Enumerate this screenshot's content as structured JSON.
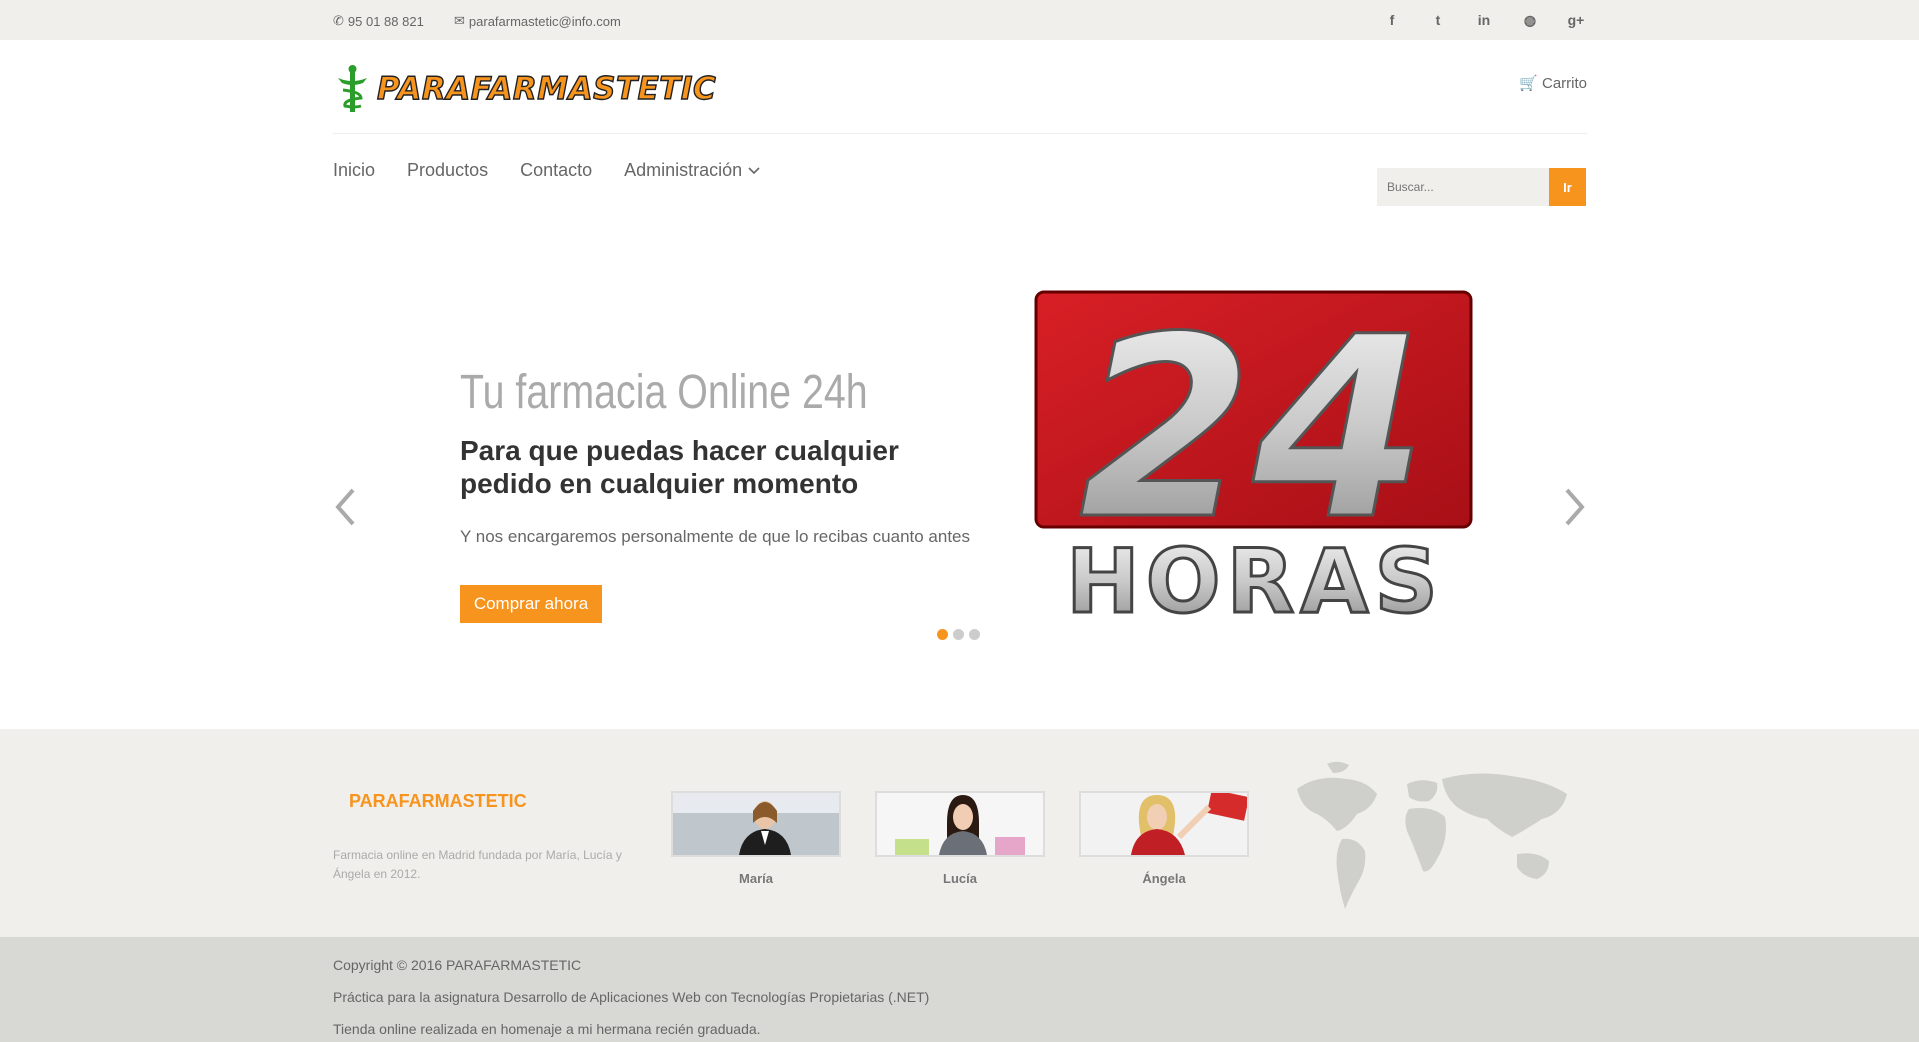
{
  "topbar": {
    "phone": "95 01 88 821",
    "email": "parafarmastetic@info.com",
    "social": [
      "facebook-icon",
      "twitter-icon",
      "linkedin-icon",
      "dribbble-icon",
      "google-plus-icon"
    ],
    "social_glyphs": [
      "f",
      "t",
      "in",
      "◍",
      "g+"
    ]
  },
  "header": {
    "logo_text": "PARAFARMASTETIC",
    "cart_label": "Carrito"
  },
  "nav": {
    "items": [
      "Inicio",
      "Productos",
      "Contacto",
      "Administración"
    ]
  },
  "search": {
    "placeholder": "Buscar...",
    "button_label": "Ir"
  },
  "slider": {
    "title": "Tu farmacia Online 24h",
    "subtitle": "Para que puedas hacer cualquier pedido en cualquier momento",
    "text": "Y nos encargaremos personalmente de que lo recibas cuanto antes",
    "cta_label": "Comprar ahora",
    "image_number": "24",
    "image_word": "HORAS",
    "slide_count": 3,
    "active_slide": 1
  },
  "about": {
    "title": "PARAFARMASTETIC",
    "description": "Farmacia online en Madrid fundada por María, Lucía y Ángela en 2012.",
    "team": [
      {
        "name": "María"
      },
      {
        "name": "Lucía"
      },
      {
        "name": "Ángela"
      }
    ]
  },
  "footer": {
    "copyright": "Copyright © 2016 PARAFARMASTETIC",
    "line2": "Práctica para la asignatura Desarrollo de Aplicaciones Web con Tecnologías Propietarias (.NET)",
    "line3": "Tienda online realizada en homenaje a mi hermana recién graduada."
  },
  "colors": {
    "accent": "#f7941d",
    "topbar_bg": "#f0efeb",
    "footer_bg": "#d8d8d5",
    "badge_red": "#c4141c"
  }
}
